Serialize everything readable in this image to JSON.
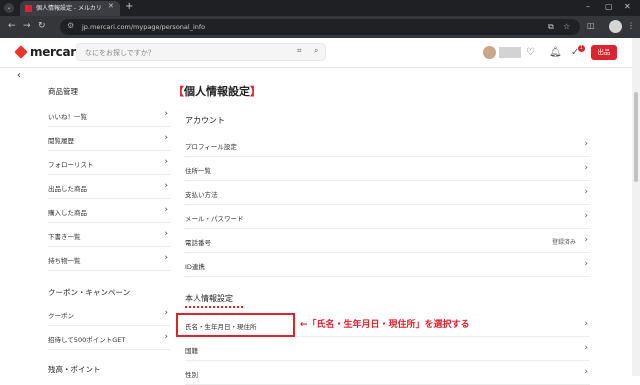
{
  "browser": {
    "tab_title": "個人情報設定 - メルカリ",
    "url": "jp.mercari.com/mypage/personal_info"
  },
  "header": {
    "logo": "mercari",
    "search_placeholder": "なにをお探しですか？",
    "sell_label": "出品",
    "notification_count": "1",
    "brand_color": "#e0212f"
  },
  "sidebar": {
    "sections": [
      {
        "heading": "商品管理",
        "items": [
          "いいね！一覧",
          "閲覧履歴",
          "フォローリスト",
          "出品した商品",
          "購入した商品",
          "下書き一覧",
          "持ち物一覧"
        ]
      },
      {
        "heading": "クーポン・キャンペーン",
        "items": [
          "クーポン",
          "招待して500ポイントGET"
        ]
      },
      {
        "heading": "残高・ポイント",
        "items": []
      }
    ]
  },
  "main": {
    "title": "個人情報設定",
    "account_heading": "アカウント",
    "account_rows": [
      {
        "label": "プロフィール設定",
        "value": ""
      },
      {
        "label": "住所一覧",
        "value": ""
      },
      {
        "label": "支払い方法",
        "value": ""
      },
      {
        "label": "メール・パスワード",
        "value": ""
      },
      {
        "label": "電話番号",
        "value": "登録済み"
      },
      {
        "label": "ID連携",
        "value": ""
      }
    ],
    "personal_heading": "本人情報設定",
    "personal_rows": [
      {
        "label": "氏名・生年月日・現住所",
        "value": ""
      },
      {
        "label": "国籍",
        "value": ""
      },
      {
        "label": "性別",
        "value": ""
      }
    ]
  },
  "annotation": "←「氏名・生年月日・現住所」を選択する"
}
